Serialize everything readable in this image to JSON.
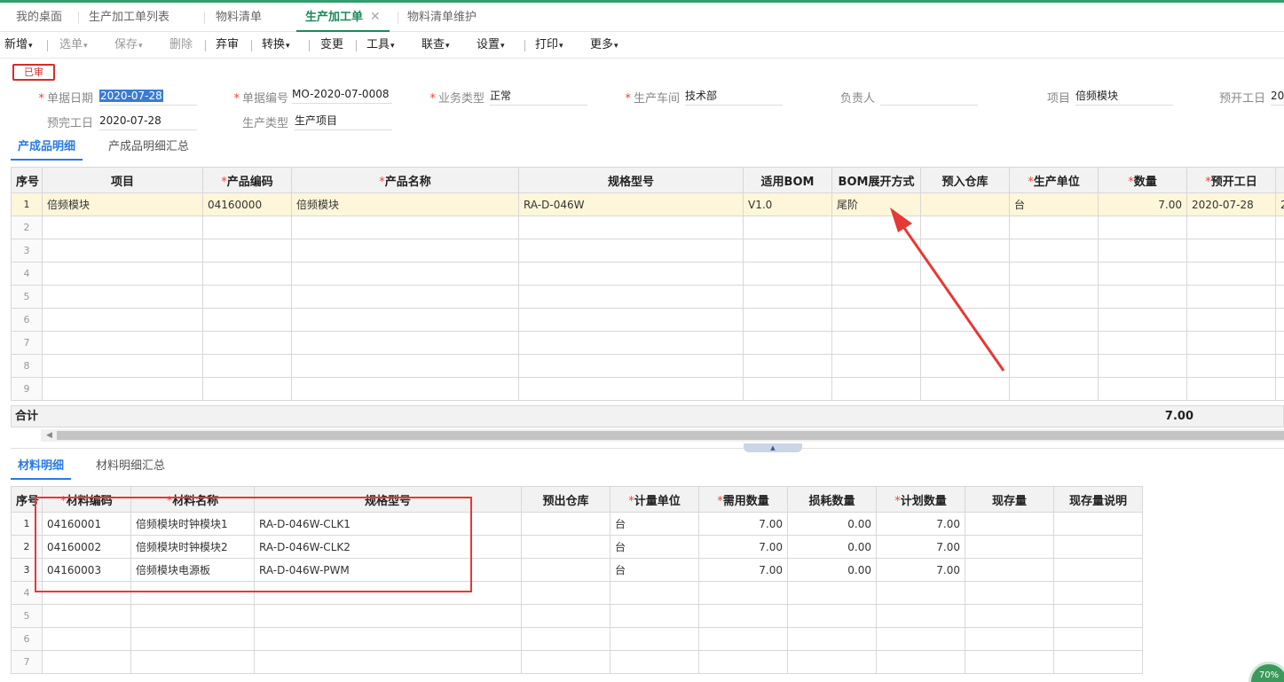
{
  "tabs": [
    {
      "label": "我的桌面"
    },
    {
      "label": "生产加工单列表"
    },
    {
      "label": "物料清单"
    },
    {
      "label": "生产加工单",
      "close": "✕"
    },
    {
      "label": "物料清单维护"
    }
  ],
  "toolbar": [
    {
      "label": "新增",
      "caret": "▾"
    },
    {
      "label": "选单",
      "caret": "▾"
    },
    {
      "label": "保存",
      "caret": "▾"
    },
    {
      "label": "删除"
    },
    {
      "label": "弃审"
    },
    {
      "label": "转换",
      "caret": "▾"
    },
    {
      "label": "变更"
    },
    {
      "label": "工具",
      "caret": "▾"
    },
    {
      "label": "联查",
      "caret": "▾"
    },
    {
      "label": "设置",
      "caret": "▾"
    },
    {
      "label": "打印",
      "caret": "▾"
    },
    {
      "label": "更多",
      "caret": "▾"
    }
  ],
  "status_stamp": "已审",
  "form": {
    "doc_date": {
      "label": "单据日期",
      "value": "2020-07-28"
    },
    "doc_no": {
      "label": "单据编号",
      "value": "MO-2020-07-0008"
    },
    "biz_type": {
      "label": "业务类型",
      "value": "正常"
    },
    "workshop": {
      "label": "生产车间",
      "value": "技术部"
    },
    "owner": {
      "label": "负责人",
      "value": ""
    },
    "project": {
      "label": "项目",
      "value": "倍频模块"
    },
    "plan_start": {
      "label": "预开工日",
      "value": "20"
    },
    "plan_finish": {
      "label": "预完工日",
      "value": "2020-07-28"
    },
    "prod_type": {
      "label": "生产类型",
      "value": "生产项目"
    }
  },
  "product_tabs": [
    {
      "label": "产成品明细"
    },
    {
      "label": "产成品明细汇总"
    }
  ],
  "product_table": {
    "headers": [
      "序号",
      "项目",
      "产品编码",
      "产品名称",
      "规格型号",
      "适用BOM",
      "BOM展开方式",
      "预入仓库",
      "生产单位",
      "数量",
      "预开工日",
      ""
    ],
    "rows": [
      [
        "1",
        "倍频模块",
        "04160000",
        "倍频模块",
        "RA-D-046W",
        "V1.0",
        "尾阶",
        "",
        "台",
        "7.00",
        "2020-07-28",
        "2"
      ],
      [
        "2",
        "",
        "",
        "",
        "",
        "",
        "",
        "",
        "",
        "",
        "",
        ""
      ],
      [
        "3",
        "",
        "",
        "",
        "",
        "",
        "",
        "",
        "",
        "",
        "",
        ""
      ],
      [
        "4",
        "",
        "",
        "",
        "",
        "",
        "",
        "",
        "",
        "",
        "",
        ""
      ],
      [
        "5",
        "",
        "",
        "",
        "",
        "",
        "",
        "",
        "",
        "",
        "",
        ""
      ],
      [
        "6",
        "",
        "",
        "",
        "",
        "",
        "",
        "",
        "",
        "",
        "",
        ""
      ],
      [
        "7",
        "",
        "",
        "",
        "",
        "",
        "",
        "",
        "",
        "",
        "",
        ""
      ],
      [
        "8",
        "",
        "",
        "",
        "",
        "",
        "",
        "",
        "",
        "",
        "",
        ""
      ],
      [
        "9",
        "",
        "",
        "",
        "",
        "",
        "",
        "",
        "",
        "",
        "",
        ""
      ]
    ],
    "total_label": "合计",
    "total_qty": "7.00"
  },
  "material_tabs": [
    {
      "label": "材料明细"
    },
    {
      "label": "材料明细汇总"
    }
  ],
  "material_table": {
    "headers": [
      "序号",
      "材料编码",
      "材料名称",
      "规格型号",
      "预出仓库",
      "计量单位",
      "需用数量",
      "损耗数量",
      "计划数量",
      "现存量",
      "现存量说明"
    ],
    "rows": [
      [
        "1",
        "04160001",
        "倍频模块时钟模块1",
        "RA-D-046W-CLK1",
        "",
        "台",
        "7.00",
        "0.00",
        "7.00",
        "",
        ""
      ],
      [
        "2",
        "04160002",
        "倍频模块时钟模块2",
        "RA-D-046W-CLK2",
        "",
        "台",
        "7.00",
        "0.00",
        "7.00",
        "",
        ""
      ],
      [
        "3",
        "04160003",
        "倍频模块电源板",
        "RA-D-046W-PWM",
        "",
        "台",
        "7.00",
        "0.00",
        "7.00",
        "",
        ""
      ],
      [
        "4",
        "",
        "",
        "",
        "",
        "",
        "",
        "",
        "",
        "",
        ""
      ],
      [
        "5",
        "",
        "",
        "",
        "",
        "",
        "",
        "",
        "",
        "",
        ""
      ],
      [
        "6",
        "",
        "",
        "",
        "",
        "",
        "",
        "",
        "",
        "",
        ""
      ],
      [
        "7",
        "",
        "",
        "",
        "",
        "",
        "",
        "",
        "",
        "",
        ""
      ]
    ]
  },
  "corner_badge": "70%",
  "colors": {
    "accent_green": "#1a8a5a",
    "accent_blue": "#2a7ae2",
    "annotation_red": "#e53935",
    "row_highlight": "#fdf6d8"
  }
}
